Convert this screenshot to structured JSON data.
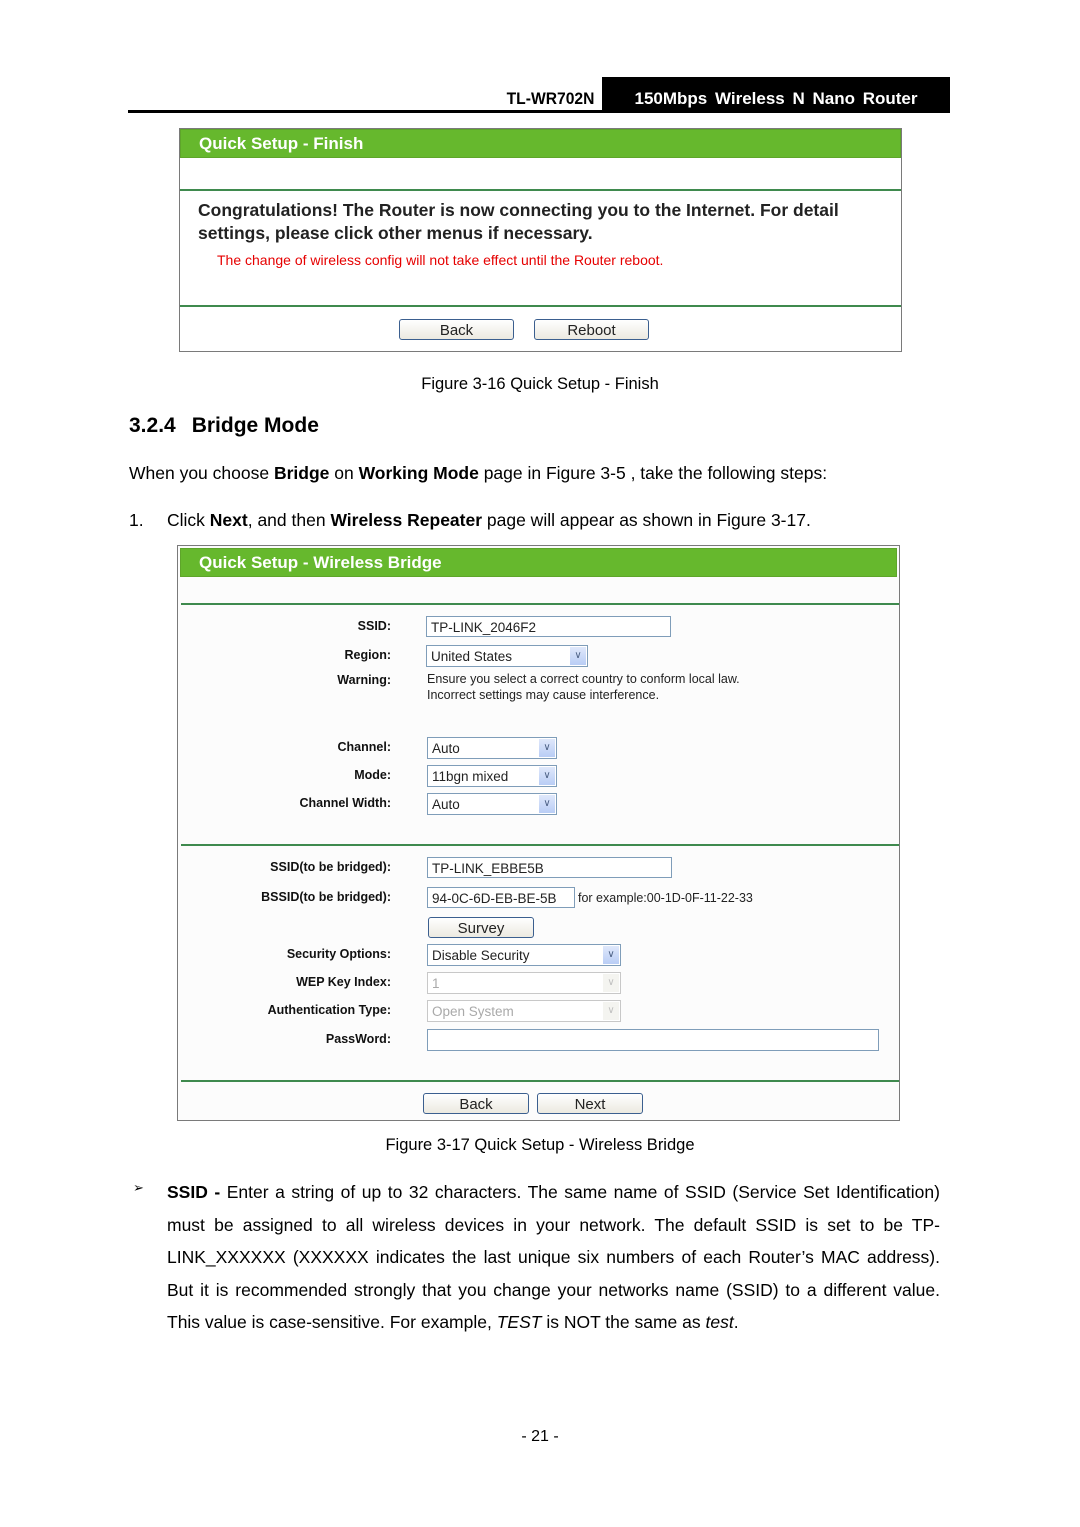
{
  "header": {
    "model": "TL-WR702N",
    "product": "150Mbps Wireless N Nano Router"
  },
  "figure_finish": {
    "title": "Quick Setup - Finish",
    "message": "Congratulations! The Router is now connecting you to the Internet. For detail settings, please click other menus if necessary.",
    "warning": "The change of wireless config will not take effect until the Router reboot.",
    "back_label": "Back",
    "reboot_label": "Reboot",
    "warning_color": "#e60000",
    "caption": "Figure 3-16 Quick Setup - Finish"
  },
  "section": {
    "number": "3.2.4",
    "title": "Bridge Mode",
    "intro": {
      "t1": "When you choose ",
      "b1": "Bridge",
      "t2": " on ",
      "b2": "Working Mode",
      "t3": " page in Figure 3-5 , take the following steps:"
    },
    "step1": {
      "num": "1.",
      "t1": "Click ",
      "b1": "Next",
      "t2": ", and then ",
      "b2": "Wireless Repeater",
      "t3": " page will appear as shown in Figure 3-17."
    }
  },
  "figure_bridge": {
    "title": "Quick Setup - Wireless Bridge",
    "fields": {
      "ssid": {
        "label": "SSID:",
        "value": "TP-LINK_2046F2"
      },
      "region": {
        "label": "Region:",
        "value": "United States"
      },
      "warning": {
        "label": "Warning:",
        "line1": "Ensure you select a correct country to conform local law.",
        "line2": "Incorrect settings may cause interference."
      },
      "channel": {
        "label": "Channel:",
        "value": "Auto"
      },
      "mode": {
        "label": "Mode:",
        "value": "11bgn mixed"
      },
      "channel_width": {
        "label": "Channel Width:",
        "value": "Auto"
      },
      "ssid_bridged": {
        "label": "SSID(to be bridged):",
        "value": "TP-LINK_EBBE5B"
      },
      "bssid_bridged": {
        "label": "BSSID(to be bridged):",
        "value": "94-0C-6D-EB-BE-5B",
        "hint": "for example:00-1D-0F-11-22-33"
      },
      "survey_label": "Survey",
      "security": {
        "label": "Security Options:",
        "value": "Disable Security"
      },
      "wep_index": {
        "label": "WEP Key Index:",
        "value": "1"
      },
      "auth_type": {
        "label": "Authentication Type:",
        "value": "Open System"
      },
      "password": {
        "label": "PassWord:",
        "value": ""
      }
    },
    "back_label": "Back",
    "next_label": "Next",
    "accent_color": "#66b82d",
    "caption": "Figure 3-17 Quick Setup - Wireless Bridge"
  },
  "ssid_desc": {
    "bullet": "➢",
    "term": "SSID - ",
    "t1": "Enter a string of up to 32 characters. The same name of SSID (Service Set Identification) must be assigned to all wireless devices in your network. The default SSID is set to be TP-LINK_XXXXXX (XXXXXX indicates the last unique six numbers of each Router’s MAC address). But it is recommended strongly that you change your networks name (SSID) to a different value. This value is case-sensitive. For example, ",
    "i1": "TEST",
    "t2": " is NOT the same as ",
    "i2": "test",
    "t3": "."
  },
  "page_number": "- 21 -"
}
